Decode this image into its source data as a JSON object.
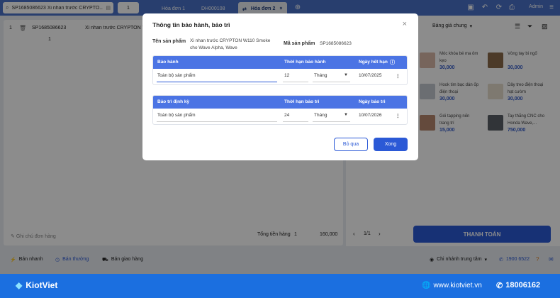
{
  "topbar": {
    "search_text": "SP1685086623 Xi nhan trước CRYPTO...",
    "quantity": "1",
    "tabs": [
      {
        "label": "Hóa đơn 1"
      },
      {
        "label": "DH000108"
      },
      {
        "label": "Hóa đơn 2"
      }
    ],
    "admin": "Admin"
  },
  "cart": {
    "row_index": "1",
    "product_code": "SP1685086623",
    "product_name": "Xi nhan trước CRYPTON W110",
    "qty": "1",
    "note_placeholder": "Ghi chú đơn hàng",
    "total_label": "Tổng tiền hàng",
    "total_qty": "1",
    "total_value": "160,000"
  },
  "right": {
    "price_list": "Bảng giá chung",
    "products": [
      {
        "name": "Móc khóa bé ma ôm kẹo",
        "price": "30,000"
      },
      {
        "name": "Vòng tay bi ngố",
        "price": "30,000"
      },
      {
        "name": "Hook tim bạc dán ốp điện thoại",
        "price": "30,000"
      },
      {
        "name": "Dây treo điện thoại hạt cườm",
        "price": "30,000"
      },
      {
        "name": "Gói tapping nến trang trí",
        "price": "15,000"
      },
      {
        "name": "Tay thắng CNC cho Honda Wave,...",
        "price": "750,000"
      }
    ],
    "pagination": "1/1",
    "pay_button": "THANH TOÁN"
  },
  "bottom": {
    "modes": [
      "Bán nhanh",
      "Bán thường",
      "Bán giao hàng"
    ],
    "branch": "Chi nhánh trung tâm",
    "hotline": "1900 6522"
  },
  "footer": {
    "brand": "KiotViet",
    "website": "www.kiotviet.vn",
    "phone": "18006162"
  },
  "modal": {
    "title": "Thông tin bảo hành, bảo trì",
    "product_name_label": "Tên sản phẩm",
    "product_name_line1": "Xi nhan trước CRYPTON W110 Smoke",
    "product_name_line2": "cho Wave Alpha, Wave",
    "product_code_label": "Mã sản phẩm",
    "product_code": "SP1685086623",
    "warranty": {
      "col1": "Bảo hành",
      "col2": "Thời hạn bảo hành",
      "col3": "Ngày hết hạn",
      "scope": "Toàn bộ sản phẩm",
      "duration": "12",
      "unit": "Tháng",
      "expiry": "10/07/2025"
    },
    "maintenance": {
      "col1": "Bảo trì định kỳ",
      "col2": "Thời hạn bảo trì",
      "col3": "Ngày bảo trì",
      "scope": "Toàn bộ sản phẩm",
      "duration": "24",
      "unit": "Tháng",
      "date": "10/07/2026"
    },
    "skip_button": "Bỏ qua",
    "done_button": "Xong"
  }
}
